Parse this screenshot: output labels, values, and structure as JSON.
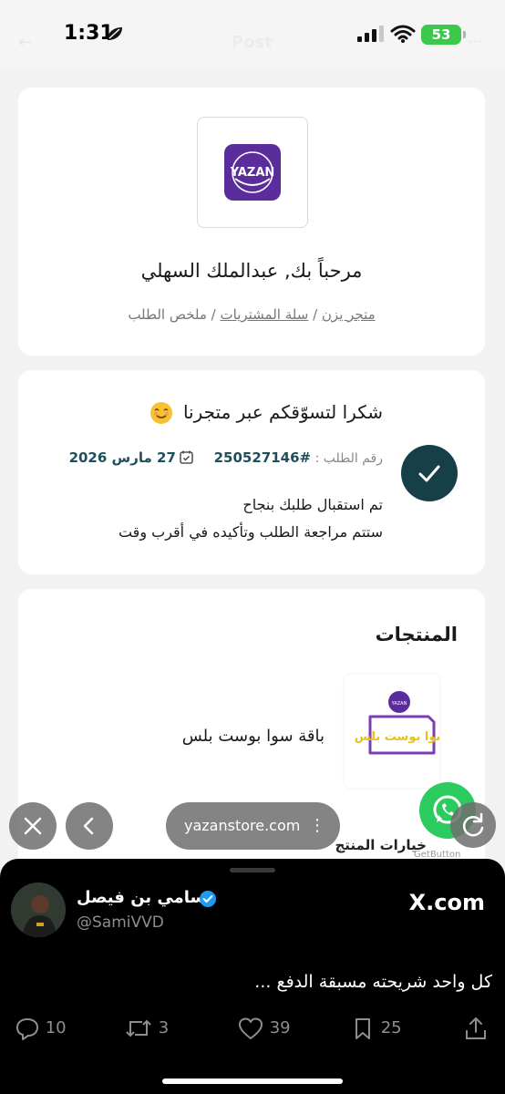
{
  "status_bar": {
    "time": "1:31",
    "battery": "53",
    "page_title": "Post"
  },
  "header_card": {
    "logo_text": "YAZAN",
    "welcome": "مرحباً بك, عبدالملك السهلي",
    "breadcrumb": {
      "store": "متجر يزن",
      "cart": "سلة المشتريات",
      "summary": "ملخص الطلب",
      "separator": " / "
    }
  },
  "order_card": {
    "title": "شكرا لتسوّقكم عبر متجرنا",
    "order_label": "رقم الطلب :",
    "order_number": "#250527146",
    "order_date": "27 مارس 2026",
    "message_line1": "تم استقبال طلبك بنجاح",
    "message_line2": "ستتم مراجعة الطلب وتأكيده في أقرب وقت"
  },
  "products_card": {
    "title": "المنتجات",
    "product_name": "باقة سوا بوست بلس",
    "product_thumb_text": "سوا بوست بلس",
    "options_label": "خيارات المنتج",
    "getbutton": "GetButton"
  },
  "browser": {
    "url": "yazanstore.com"
  },
  "tweet": {
    "author": "سامي بن فيصل",
    "handle": "@SamiVVD",
    "site": "X.com",
    "text": "كل واحد شريحته مسبقة الدفع ...",
    "replies": "10",
    "retweets": "3",
    "likes": "39",
    "bookmarks": "25"
  },
  "colors": {
    "accent_dark_teal": "#163f48",
    "brand_purple": "#5b2d9c",
    "whatsapp_green": "#2ccb5f",
    "battery_green": "#3cc84a"
  }
}
